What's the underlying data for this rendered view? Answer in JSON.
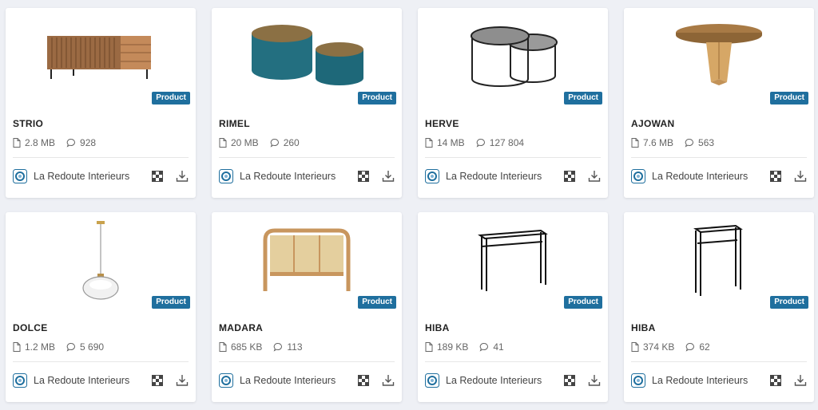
{
  "badge_label": "Product",
  "accent_color": "#1f6f9e",
  "cards": [
    {
      "title": "STRIO",
      "size": "2.8 MB",
      "count": "928",
      "author": "La Redoute Interieurs"
    },
    {
      "title": "RIMEL",
      "size": "20 MB",
      "count": "260",
      "author": "La Redoute Interieurs"
    },
    {
      "title": "HERVE",
      "size": "14 MB",
      "count": "127 804",
      "author": "La Redoute Interieurs"
    },
    {
      "title": "AJOWAN",
      "size": "7.6 MB",
      "count": "563",
      "author": "La Redoute Interieurs"
    },
    {
      "title": "DOLCE",
      "size": "1.2 MB",
      "count": "5 690",
      "author": "La Redoute Interieurs"
    },
    {
      "title": "MADARA",
      "size": "685 KB",
      "count": "113",
      "author": "La Redoute Interieurs"
    },
    {
      "title": "HIBA",
      "size": "189 KB",
      "count": "41",
      "author": "La Redoute Interieurs"
    },
    {
      "title": "HIBA",
      "size": "374 KB",
      "count": "62",
      "author": "La Redoute Interieurs"
    }
  ],
  "icons": {
    "file": "file-icon",
    "count": "comment-icon",
    "author_logo": "la-redoute-logo-icon",
    "ar": "checkered-cube-icon",
    "download": "download-icon"
  }
}
